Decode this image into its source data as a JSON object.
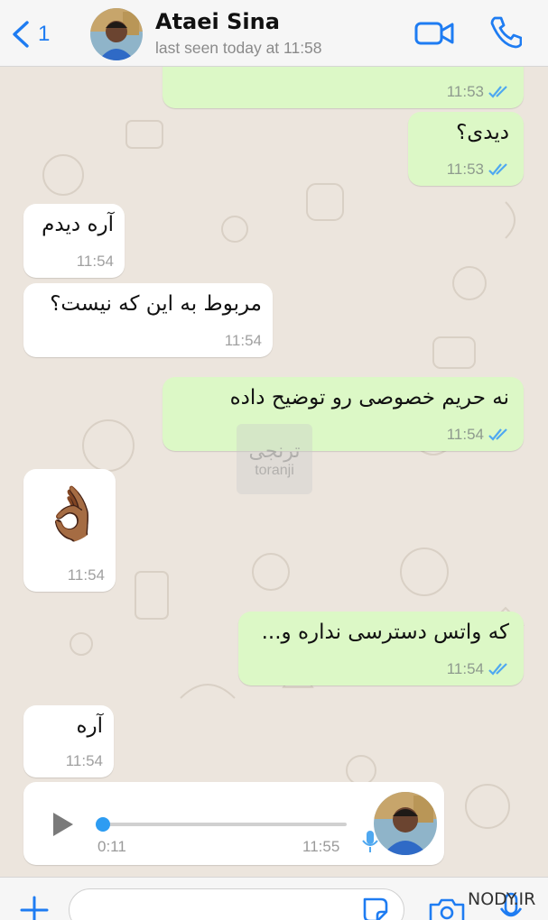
{
  "header": {
    "back_count": "1",
    "contact_name": "Ataei Sina",
    "status": "last seen today at 11:58"
  },
  "messages": [
    {
      "direction": "out",
      "text": "",
      "time": "11:53",
      "read": true
    },
    {
      "direction": "out",
      "text": "دیدی؟",
      "time": "11:53",
      "read": true
    },
    {
      "direction": "in",
      "text": "آره دیدم",
      "time": "11:54"
    },
    {
      "direction": "in",
      "text": "مربوط به این که نیست؟",
      "time": "11:54"
    },
    {
      "direction": "out",
      "text": "نه حریم خصوصی رو توضیح داده",
      "time": "11:54",
      "read": true
    },
    {
      "direction": "in",
      "text": "👌🏾",
      "time": "11:54"
    },
    {
      "direction": "out",
      "text": "که واتس دسترسی نداره و...",
      "time": "11:54",
      "read": true
    },
    {
      "direction": "in",
      "text": "آره",
      "time": "11:54"
    }
  ],
  "voice_message": {
    "duration": "0:11",
    "time": "11:55",
    "progress": 0
  },
  "watermark": {
    "line1": "ترنجی",
    "line2": "toranji"
  },
  "footer_watermark": "NODY.IR",
  "colors": {
    "outgoing_bubble": "#dcf8c6",
    "incoming_bubble": "#ffffff",
    "accent": "#1e7cf2",
    "read_ticks": "#4fa8f0"
  }
}
